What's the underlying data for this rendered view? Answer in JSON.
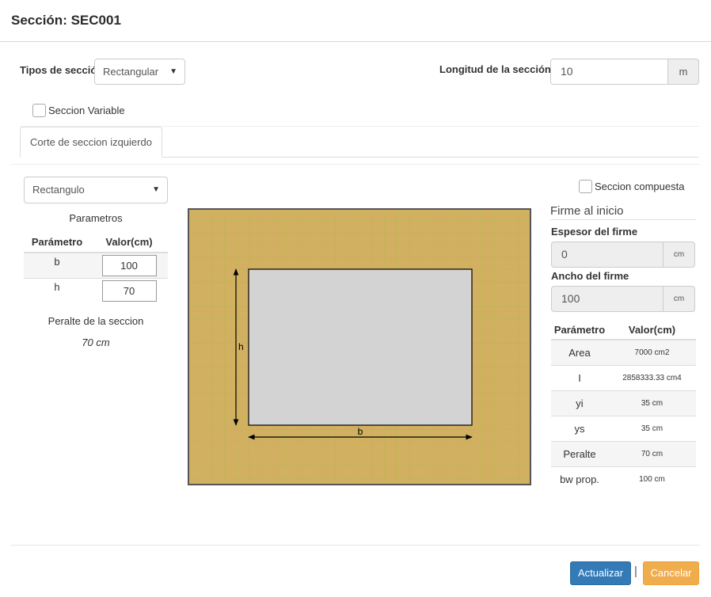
{
  "dialog": {
    "title": "Sección: SEC001"
  },
  "section_type": {
    "label": "Tipos de sección",
    "value": "Rectangular"
  },
  "length": {
    "label": "Longitud de la sección:",
    "value": "10",
    "unit": "m"
  },
  "variable_section": {
    "label": "Seccion Variable",
    "checked": false
  },
  "tabs": [
    {
      "label": "Corte de seccion izquierdo",
      "active": true
    }
  ],
  "shape": {
    "value": "Rectangulo"
  },
  "params": {
    "title": "Parametros",
    "headers": [
      "Parámetro",
      "Valor(cm)"
    ],
    "rows": [
      {
        "name": "b",
        "value": "100"
      },
      {
        "name": "h",
        "value": "70"
      }
    ],
    "depth_label": "Peralte de la seccion",
    "depth_value": "70 cm"
  },
  "drawing": {
    "b_label": "b",
    "h_label": "h",
    "b_cm": 100,
    "h_cm": 70
  },
  "composite": {
    "label": "Seccion compuesta",
    "checked": false
  },
  "firm": {
    "title": "Firme al inicio",
    "thickness_label": "Espesor del firme",
    "thickness_value": "0",
    "thickness_unit": "cm",
    "width_label": "Ancho del firme",
    "width_value": "100",
    "width_unit": "cm"
  },
  "results": {
    "headers": [
      "Parámetro",
      "Valor(cm)"
    ],
    "rows": [
      {
        "name": "Area",
        "value": "7000 cm2"
      },
      {
        "name": "I",
        "value": "2858333.33 cm4"
      },
      {
        "name": "yi",
        "value": "35 cm"
      },
      {
        "name": "ys",
        "value": "35 cm"
      },
      {
        "name": "Peralte",
        "value": "70 cm"
      },
      {
        "name": "bw prop.",
        "value": "100 cm"
      }
    ]
  },
  "buttons": {
    "update": "Actualizar",
    "separator": "|",
    "cancel": "Cancelar"
  },
  "colors": {
    "primary": "#337ab7",
    "warning": "#f0ad4e",
    "background_fill": "#d2b061",
    "grid": "#b6b848",
    "section_fill": "#d3d3d3"
  }
}
